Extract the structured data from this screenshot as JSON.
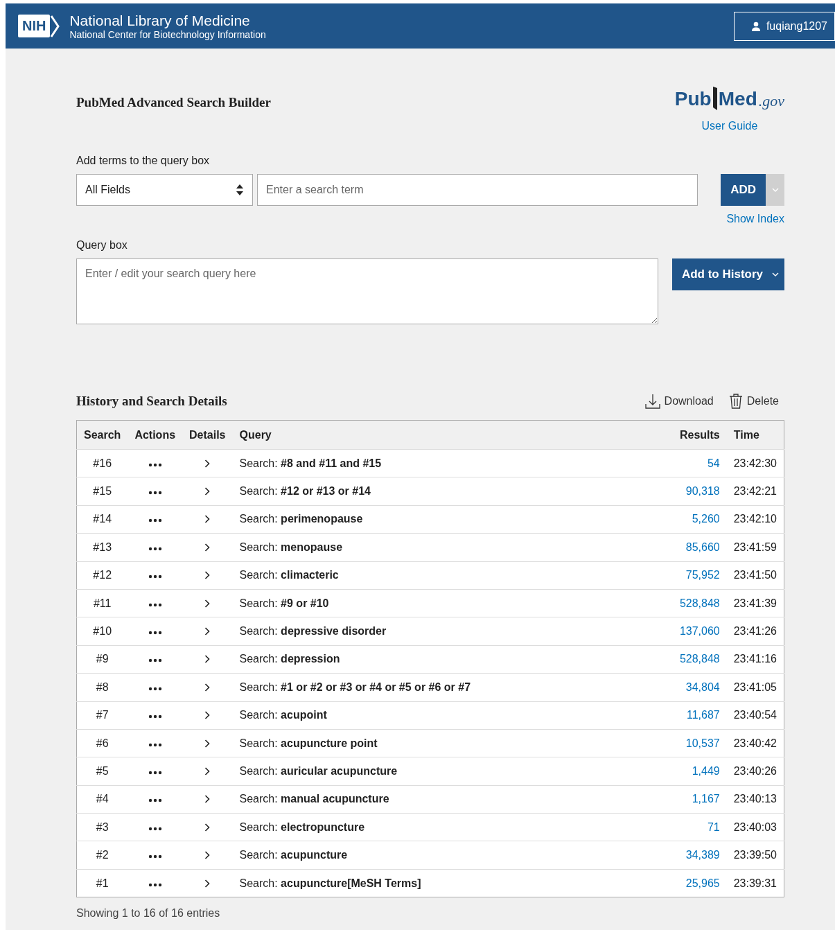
{
  "header": {
    "org_abbr": "NIH",
    "org_name": "National Library of Medicine",
    "org_sub": "National Center for Biotechnology Information",
    "user": "fuqiang1207"
  },
  "title": "PubMed Advanced Search Builder",
  "logo": {
    "pub": "Pub",
    "med": "Med",
    "gov": ".gov"
  },
  "user_guide": "User Guide",
  "add_terms": {
    "label": "Add terms to the query box",
    "field": "All Fields",
    "placeholder": "Enter a search term",
    "button": "ADD",
    "show_index": "Show Index"
  },
  "query_box": {
    "label": "Query box",
    "placeholder": "Enter / edit your search query here",
    "button": "Add to History"
  },
  "history": {
    "title": "History and Search Details",
    "download": "Download",
    "delete": "Delete",
    "columns": [
      "Search",
      "Actions",
      "Details",
      "Query",
      "Results",
      "Time"
    ],
    "rows": [
      {
        "search": "#16",
        "query": "Search: **#8 and #11 and #15**",
        "results": "54",
        "time": "23:42:30"
      },
      {
        "search": "#15",
        "query": "Search: **#12 or #13 or #14**",
        "results": "90,318",
        "time": "23:42:21"
      },
      {
        "search": "#14",
        "query": "Search: **perimenopause**",
        "results": "5,260",
        "time": "23:42:10"
      },
      {
        "search": "#13",
        "query": "Search: **menopause**",
        "results": "85,660",
        "time": "23:41:59"
      },
      {
        "search": "#12",
        "query": "Search: **climacteric**",
        "results": "75,952",
        "time": "23:41:50"
      },
      {
        "search": "#11",
        "query": "Search: **#9 or #10**",
        "results": "528,848",
        "time": "23:41:39"
      },
      {
        "search": "#10",
        "query": "Search: **depressive disorder**",
        "results": "137,060",
        "time": "23:41:26"
      },
      {
        "search": "#9",
        "query": "Search: **depression**",
        "results": "528,848",
        "time": "23:41:16"
      },
      {
        "search": "#8",
        "query": "Search: **#1 or #2 or #3 or #4 or #5 or #6 or #7**",
        "results": "34,804",
        "time": "23:41:05"
      },
      {
        "search": "#7",
        "query": "Search: **acupoint**",
        "results": "11,687",
        "time": "23:40:54"
      },
      {
        "search": "#6",
        "query": "Search: **acupuncture point**",
        "results": "10,537",
        "time": "23:40:42"
      },
      {
        "search": "#5",
        "query": "Search: **auricular acupuncture**",
        "results": "1,449",
        "time": "23:40:26"
      },
      {
        "search": "#4",
        "query": "Search: **manual acupuncture**",
        "results": "1,167",
        "time": "23:40:13"
      },
      {
        "search": "#3",
        "query": "Search: **electropuncture**",
        "results": "71",
        "time": "23:40:03"
      },
      {
        "search": "#2",
        "query": "Search: **acupuncture**",
        "results": "34,389",
        "time": "23:39:50"
      },
      {
        "search": "#1",
        "query": "Search: **acupuncture[MeSH Terms]**",
        "results": "25,965",
        "time": "23:39:31"
      }
    ],
    "footer": "Showing 1 to 16 of 16 entries"
  }
}
